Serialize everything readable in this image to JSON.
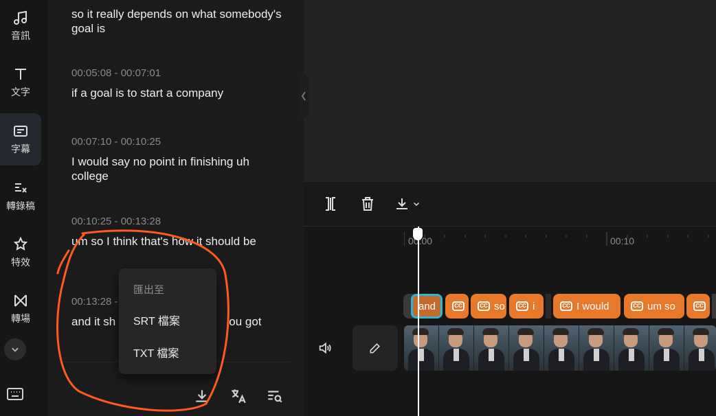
{
  "sidebar": {
    "items": [
      {
        "label": "音訊",
        "icon": "music-note-icon"
      },
      {
        "label": "文字",
        "icon": "text-icon"
      },
      {
        "label": "字幕",
        "icon": "captions-icon",
        "active": true
      },
      {
        "label": "轉錄稿",
        "icon": "transcript-icon"
      },
      {
        "label": "特效",
        "icon": "effects-icon"
      },
      {
        "label": "轉場",
        "icon": "transition-icon"
      }
    ],
    "collapse_icon": "chevron-down-icon",
    "keyboard_icon": "keyboard-icon"
  },
  "captions": [
    {
      "time": "",
      "text": "so it really depends on what somebody's goal is"
    },
    {
      "time": "00:05:08 - 00:07:01",
      "text": "if a goal is to start a company"
    },
    {
      "time": "00:07:10 - 00:10:25",
      "text": "I would say no point in finishing uh college"
    },
    {
      "time": "00:10:25 - 00:13:28",
      "text": "um so I think that's how it should be"
    },
    {
      "time": "00:13:28 -",
      "text": "and it sh",
      "text_tail": "ou got"
    }
  ],
  "export_menu": {
    "heading": "匯出至",
    "options": [
      "SRT 檔案",
      "TXT 檔案"
    ]
  },
  "panel_footer": {
    "icons": [
      "download-icon",
      "translate-icon",
      "search-list-icon"
    ]
  },
  "toolbar": {
    "icons": [
      "split-icon",
      "delete-icon",
      "download-icon",
      "chevron-down-icon"
    ]
  },
  "timeline": {
    "ticks": [
      "00:00",
      "00:10"
    ],
    "caption_clips": [
      "and",
      "",
      "so",
      "i",
      "I would",
      "um so",
      ""
    ],
    "mute_icon": "speaker-icon",
    "edit_icon": "pencil-icon"
  },
  "colors": {
    "accent": "#e8782a",
    "selected_outline": "#2fb6d6",
    "annotation": "#ff5a1f"
  }
}
